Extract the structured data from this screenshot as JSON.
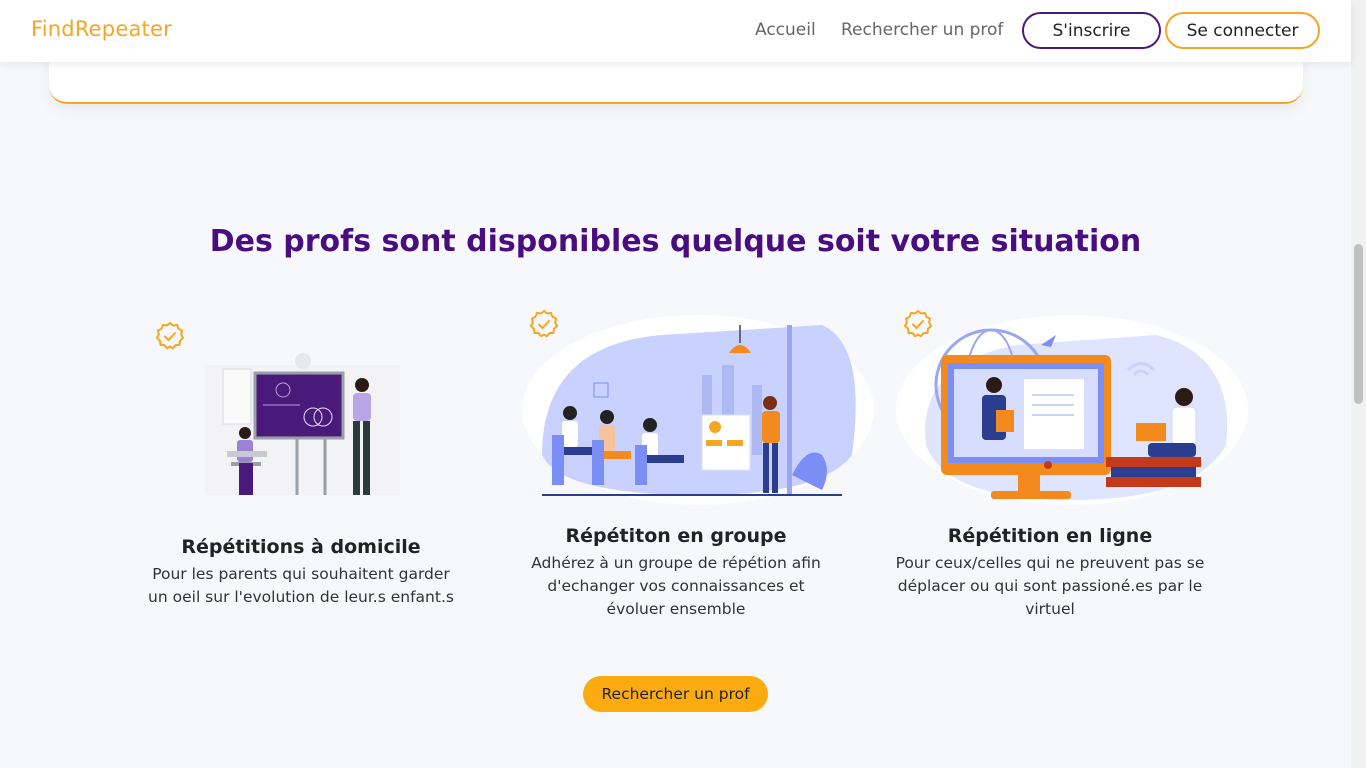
{
  "header": {
    "brand": "FindRepeater",
    "nav": [
      "Accueil",
      "Rechercher un prof"
    ],
    "signup_label": "S'inscrire",
    "login_label": "Se connecter"
  },
  "section": {
    "title": "Des profs sont disponibles quelque soit votre situation"
  },
  "features": [
    {
      "title": "Répétitions à domicile",
      "description": "Pour les parents qui souhaitent garder un oeil sur l'evolution de leur.s enfant.s"
    },
    {
      "title": "Répétiton en groupe",
      "description": "Adhérez à un groupe de répétion afin d'echanger vos connaissances et évoluer ensemble"
    },
    {
      "title": "Répétition en ligne",
      "description": "Pour ceux/celles qui ne preuvent pas se déplacer ou qui sont passioné.es par le virtuel"
    }
  ],
  "cta_label": "Rechercher un prof",
  "colors": {
    "brand": "#f5a623",
    "title": "#4a0d80",
    "cta": "#fbab0f",
    "illustration_purple": "#4a1a7a",
    "illustration_orange": "#f28a1e",
    "illustration_blue": "#7a8ef5"
  },
  "icons": [
    "check-badge-icon"
  ]
}
